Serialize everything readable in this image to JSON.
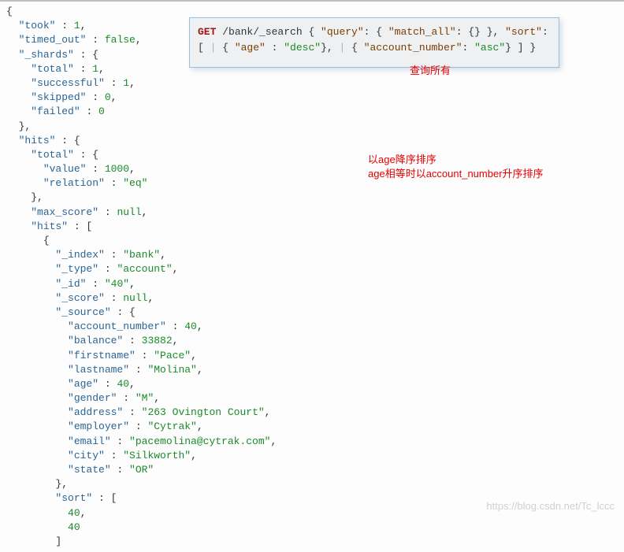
{
  "main_json": {
    "l1": "{",
    "took_k": "\"took\"",
    "took_v": "1",
    "timed_out_k": "\"timed_out\"",
    "timed_out_v": "false",
    "shards_k": "\"_shards\"",
    "total_k": "\"total\"",
    "total_v": "1",
    "successful_k": "\"successful\"",
    "successful_v": "1",
    "skipped_k": "\"skipped\"",
    "skipped_v": "0",
    "failed_k": "\"failed\"",
    "failed_v": "0",
    "hits_k": "\"hits\"",
    "htotal_k": "\"total\"",
    "value_k": "\"value\"",
    "value_v": "1000",
    "relation_k": "\"relation\"",
    "relation_v": "\"eq\"",
    "max_score_k": "\"max_score\"",
    "max_score_v": "null",
    "hits_arr_k": "\"hits\"",
    "index_k": "\"_index\"",
    "index_v": "\"bank\"",
    "type_k": "\"_type\"",
    "type_v": "\"account\"",
    "id_k": "\"_id\"",
    "id_v": "\"40\"",
    "score_k": "\"_score\"",
    "score_v": "null",
    "source_k": "\"_source\"",
    "acctnum_k": "\"account_number\"",
    "acctnum_v": "40",
    "balance_k": "\"balance\"",
    "balance_v": "33882",
    "firstname_k": "\"firstname\"",
    "firstname_v": "\"Pace\"",
    "lastname_k": "\"lastname\"",
    "lastname_v": "\"Molina\"",
    "age_k": "\"age\"",
    "age_v": "40",
    "gender_k": "\"gender\"",
    "gender_v": "\"M\"",
    "address_k": "\"address\"",
    "address_v": "\"263 Ovington Court\"",
    "employer_k": "\"employer\"",
    "employer_v": "\"Cytrak\"",
    "email_k": "\"email\"",
    "email_v": "\"pacemolina@cytrak.com\"",
    "city_k": "\"city\"",
    "city_v": "\"Silkworth\"",
    "state_k": "\"state\"",
    "state_v": "\"OR\"",
    "sort_k": "\"sort\"",
    "sort_v1": "40",
    "sort_v2": "40"
  },
  "overlay": {
    "method": "GET",
    "path": "/bank/_search",
    "query_k": "\"query\"",
    "match_all_k": "\"match_all\"",
    "sort_k": "\"sort\"",
    "age_k": "\"age\"",
    "desc_v": "\"desc\"",
    "acctnum_k": "\"account_number\"",
    "asc_v": "\"asc\""
  },
  "annotations": {
    "query_all": "查询所有",
    "sort_desc": "以age降序排序",
    "sort_tie": "age相等时以account_number升序排序"
  },
  "watermark": "https://blog.csdn.net/Tc_lccc"
}
